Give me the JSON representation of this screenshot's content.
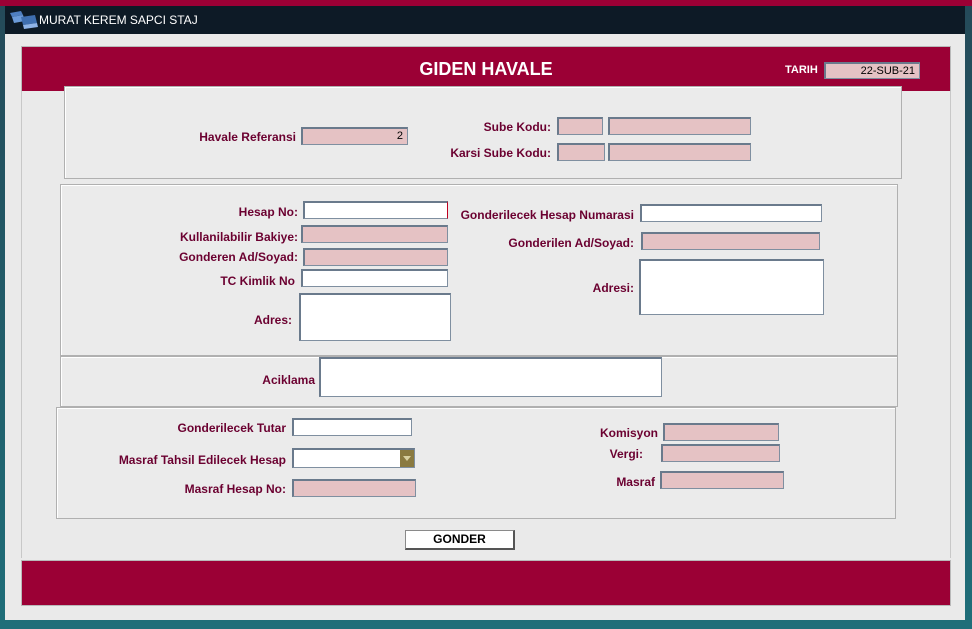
{
  "window": {
    "title": "MURAT KEREM SAPCI STAJ",
    "icon": "app-icon"
  },
  "header": {
    "title": "GIDEN HAVALE",
    "tarih_label": "TARIH",
    "tarih_value": "22-SUB-21"
  },
  "section1": {
    "havale_ref_label": "Havale Referansi",
    "havale_ref_value": "2",
    "sube_kodu_label": "Sube Kodu:",
    "karsi_sube_kodu_label": "Karsi Sube Kodu:"
  },
  "section2": {
    "hesap_no_label": "Hesap No:",
    "kullanilabilir_bakiye_label": "Kullanilabilir Bakiye:",
    "gonderen_label": "Gonderen Ad/Soyad:",
    "tc_kimlik_label": "TC Kimlik No",
    "adres_label": "Adres:",
    "gonderilecek_hesap_label": "Gonderilecek Hesap Numarasi",
    "gonderilen_label": "Gonderilen Ad/Soyad:",
    "adresi_label": "Adresi:"
  },
  "section3": {
    "aciklama_label": "Aciklama"
  },
  "section4": {
    "tutar_label": "Gonderilecek Tutar",
    "masraf_tahsil_label": "Masraf Tahsil Edilecek Hesap",
    "masraf_hesap_label": "Masraf Hesap No:",
    "komisyon_label": "Komisyon",
    "vergi_label": "Vergi:",
    "masraf_label": "Masraf"
  },
  "actions": {
    "gonder_label": "GONDER"
  },
  "colors": {
    "brand": "#9b0035",
    "label": "#6b0030",
    "readonly_field": "#e5c2c4"
  }
}
